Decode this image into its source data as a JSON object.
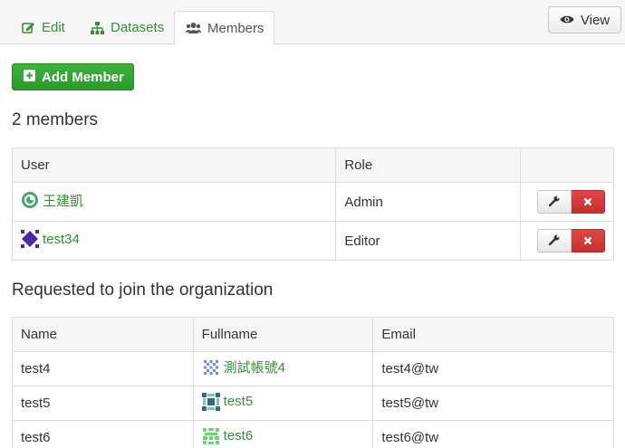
{
  "tabs": [
    {
      "label": "Edit",
      "icon": "edit-icon"
    },
    {
      "label": "Datasets",
      "icon": "sitemap-icon"
    },
    {
      "label": "Members",
      "icon": "group-icon"
    }
  ],
  "view_button": {
    "label": "View",
    "icon": "eye-icon"
  },
  "add_member_button": {
    "label": "Add Member",
    "icon": "plus-square-icon"
  },
  "members_heading": "2 members",
  "members_table": {
    "headers": [
      "User",
      "Role",
      ""
    ],
    "rows": [
      {
        "user": "王建凱",
        "role": "Admin"
      },
      {
        "user": "test34",
        "role": "Editor"
      }
    ]
  },
  "requests_heading": "Requested to join the organization",
  "requests_table": {
    "headers": [
      "Name",
      "Fullname",
      "Email"
    ],
    "rows": [
      {
        "name": "test4",
        "fullname": "測試帳號4",
        "email": "test4@tw"
      },
      {
        "name": "test5",
        "fullname": "test5",
        "email": "test5@tw"
      },
      {
        "name": "test6",
        "fullname": "test6",
        "email": "test6@tw"
      }
    ]
  },
  "colors": {
    "link": "#3a8c3a",
    "success": "#2ea32e",
    "danger": "#d43a3a"
  }
}
